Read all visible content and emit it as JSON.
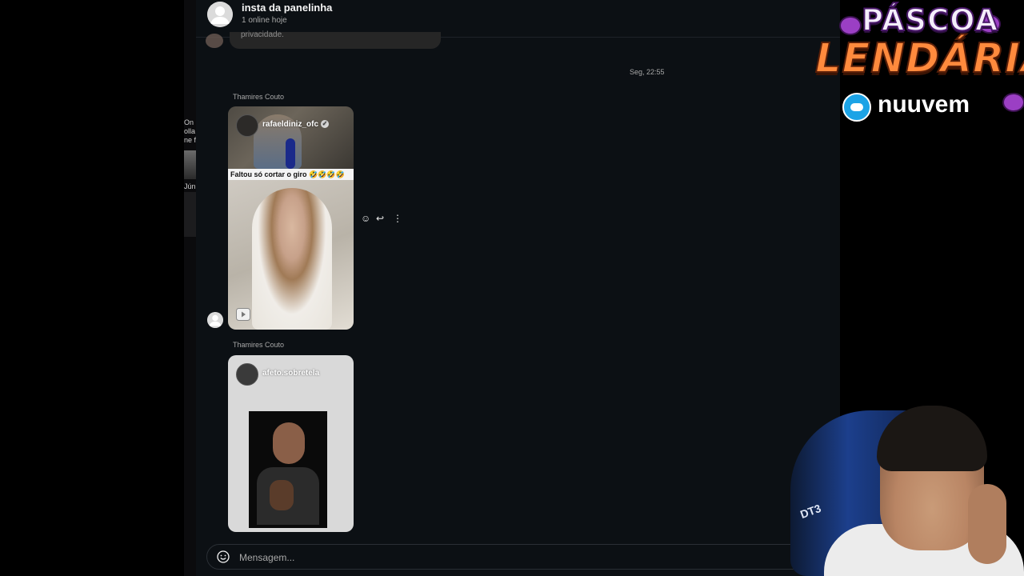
{
  "chat": {
    "title": "insta da panelinha",
    "subtitle": "1 online hoje",
    "previous_message_fragment": "privacidade.",
    "date_separator": "Seg, 22:55",
    "messages": [
      {
        "sender": "Thamires Couto",
        "type": "reel",
        "account": "rafaeldiniz_ofc",
        "verified": true,
        "caption": "Faltou só cortar o giro 🤣🤣🤣🤣🤣"
      },
      {
        "sender": "Thamires Couto",
        "type": "reel",
        "account": "afeto.sobretela"
      }
    ],
    "message_actions": [
      "react-icon",
      "reply-icon",
      "more-options-icon"
    ],
    "composer": {
      "placeholder": "Mensagem..."
    }
  },
  "side_strip": {
    "fragments": [
      "On",
      "olla",
      "ne fa",
      "Júni"
    ]
  },
  "overlay": {
    "promo_line1": "PÁSCOA",
    "promo_line2": "LENDÁRIA",
    "brand": "nuuvem",
    "chair_label": "DT3"
  },
  "colors": {
    "background": "#0c1014",
    "header_text": "#f5f5f5",
    "muted_text": "#a8a8a8",
    "promo_orange": "#ff8a3d",
    "promo_purple": "#9b3fc4",
    "brand_blue": "#1ca3e6"
  }
}
